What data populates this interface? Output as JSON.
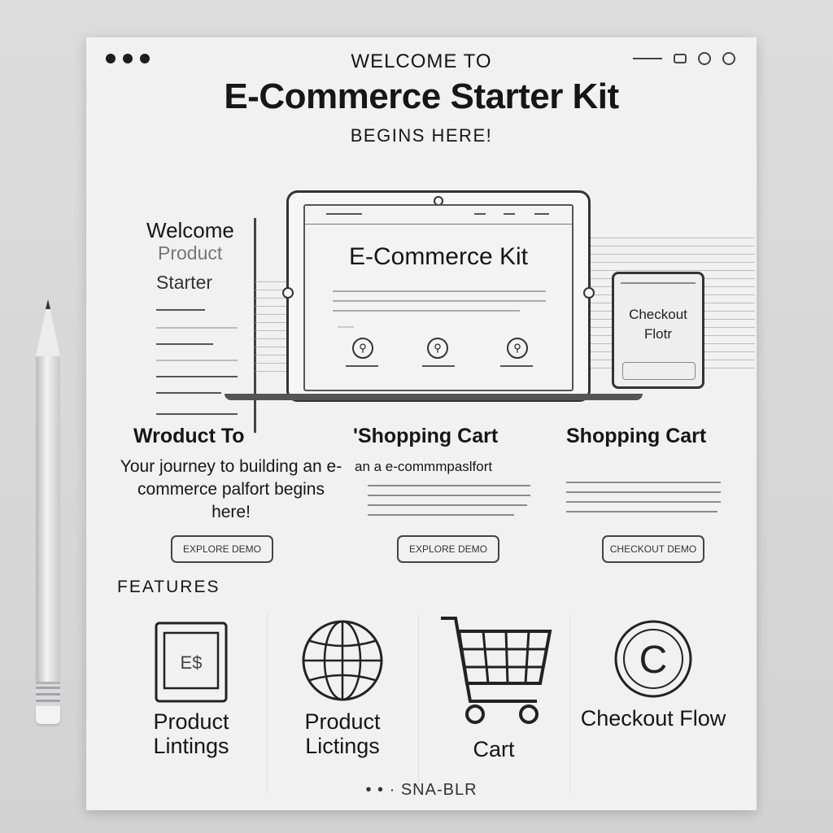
{
  "hero": {
    "welcome": "WELCOME TO",
    "title": "E-Commerce Starter Kit",
    "subtitle": "BEGINS HERE!"
  },
  "left_panel": {
    "welcome": "Welcome",
    "product": "Product",
    "starter": "Starter"
  },
  "laptop_screen": {
    "title": "E-Commerce Kit"
  },
  "phone": {
    "text": "Checkout Flotr"
  },
  "columns": [
    {
      "heading": "Wroduct  To",
      "body": "Your journey to building an e-commerce palfort begins here!",
      "button": "EXPLORE DEMO"
    },
    {
      "heading": "'Shopping Cart",
      "body": "an a e-commmpaslfort",
      "button": "EXPLORE DEMO"
    },
    {
      "heading": "Shopping Cart",
      "body": "",
      "button": "CHECKOUT DEMO"
    }
  ],
  "features": {
    "label": "FEATURES",
    "items": [
      {
        "label": "Product Lintings",
        "icon": "product-listing-icon",
        "badge": "E$"
      },
      {
        "label": "Product Lictings",
        "icon": "globe-icon"
      },
      {
        "label": "Cart",
        "icon": "shopping-cart-icon"
      },
      {
        "label": "Checkout Flow",
        "icon": "checkout-c-icon",
        "badge": "C"
      }
    ]
  },
  "footer": {
    "text": "• • · SNA-BLR"
  }
}
